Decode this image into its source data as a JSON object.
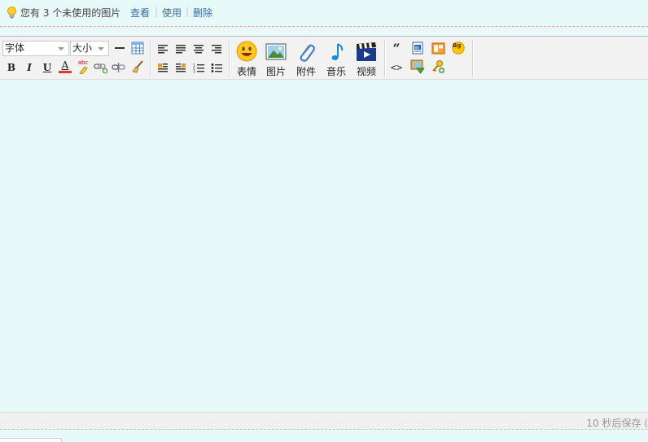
{
  "notice": {
    "message": "您有 3 个未使用的图片",
    "view_label": "查看",
    "use_label": "使用",
    "delete_label": "删除",
    "separator": "|"
  },
  "toolbar": {
    "font_select": "字体",
    "size_select": "大小",
    "bold_label": "B",
    "italic_label": "I",
    "underline_label": "U",
    "fontcolor_label": "A",
    "highlight_label": "abc",
    "emoji_label": "表情",
    "image_label": "图片",
    "attach_label": "附件",
    "music_label": "音乐",
    "video_label": "视频",
    "quote_label": "“",
    "bgcolor_label": "Bg",
    "code_label": "<>"
  },
  "status": {
    "autosave": "10 秒后保存 ("
  },
  "colors": {
    "background": "#e8f9f9",
    "link": "#3a6ea5",
    "font_color_bar": "#e03c28"
  }
}
